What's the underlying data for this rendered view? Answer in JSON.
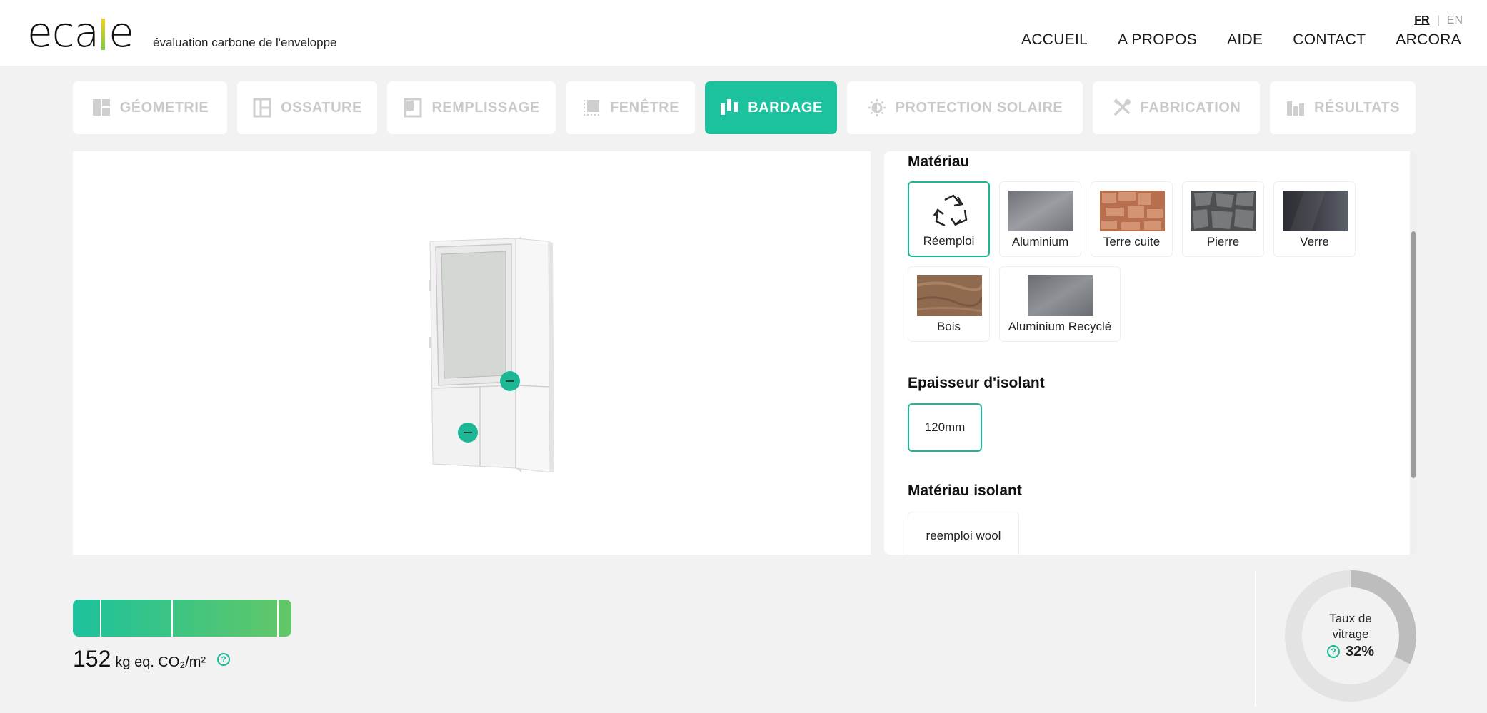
{
  "header": {
    "logo": "ecale",
    "tagline": "évaluation carbone de l'enveloppe",
    "lang": {
      "active": "FR",
      "separator": "|",
      "inactive": "EN"
    },
    "nav": [
      "ACCUEIL",
      "A PROPOS",
      "AIDE",
      "CONTACT",
      "ARCORA"
    ]
  },
  "tabs": [
    {
      "label": "GÉOMETRIE",
      "icon": "geometry-icon"
    },
    {
      "label": "OSSATURE",
      "icon": "frame-icon"
    },
    {
      "label": "REMPLISSAGE",
      "icon": "infill-icon"
    },
    {
      "label": "FENÊTRE",
      "icon": "window-icon"
    },
    {
      "label": "BARDAGE",
      "icon": "cladding-icon",
      "active": true
    },
    {
      "label": "PROTECTION SOLAIRE",
      "icon": "sun-protection-icon"
    },
    {
      "label": "FABRICATION",
      "icon": "tools-icon"
    },
    {
      "label": "RÉSULTATS",
      "icon": "bar-chart-icon"
    }
  ],
  "panel": {
    "materiau_title": "Matériau",
    "materials": [
      {
        "label": "Réemploi",
        "selected": true,
        "icon": "recycle-icon"
      },
      {
        "label": "Aluminium",
        "color": "#8a8d92"
      },
      {
        "label": "Terre cuite",
        "color": "#b86f4e"
      },
      {
        "label": "Pierre",
        "color": "#55585a"
      },
      {
        "label": "Verre",
        "color": "#3b3d44"
      },
      {
        "label": "Bois",
        "color": "#8f6a4f"
      },
      {
        "label": "Aluminium Recyclé",
        "color": "#7d8085"
      }
    ],
    "epaisseur_title": "Epaisseur d'isolant",
    "epaisseur_option": "120mm",
    "isolant_title": "Matériau isolant",
    "isolant_option": "reemploi wool"
  },
  "result": {
    "value": "152",
    "unit": "kg eq. CO₂/m²",
    "gauge_fill": 1.0
  },
  "vitrage": {
    "label_line1": "Taux de",
    "label_line2": "vitrage",
    "value": "32%",
    "fraction": 0.32
  },
  "colors": {
    "accent": "#1cc29d",
    "accent_dark": "#1cb896",
    "inactive_tab_text": "#c9c9c9"
  }
}
